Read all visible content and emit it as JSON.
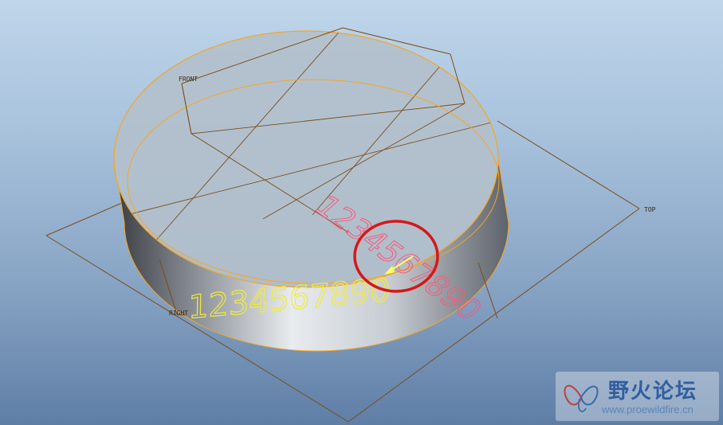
{
  "planes": {
    "front": "FRONT",
    "top": "TOP",
    "right": "RIGHT"
  },
  "text": {
    "top_face": "1234567890",
    "side_face": "1234567890"
  },
  "watermark": {
    "title": "野火论坛",
    "url": "www.proewildfire.cn"
  },
  "colors": {
    "background_top": "#bfd6ea",
    "background_bottom": "#5f7ea6",
    "edge_highlight": "#f5a623",
    "datum_plane": "#7a4d1a",
    "top_text": "#ff5577",
    "side_text": "#f2ea3a",
    "highlight_circle": "#d61818",
    "direction_arrow": "#ffff66"
  }
}
